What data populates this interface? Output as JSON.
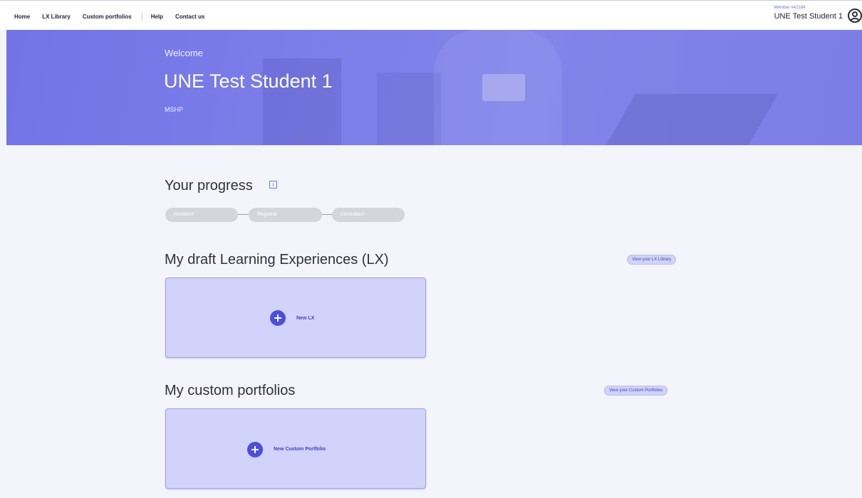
{
  "nav": {
    "items": [
      {
        "label": "Home"
      },
      {
        "label": "LX Library"
      },
      {
        "label": "Custom portfolios"
      },
      {
        "label": "Help"
      },
      {
        "label": "Contact us"
      }
    ]
  },
  "user": {
    "member_label": "Member #42184",
    "name": "UNE Test Student 1",
    "icon": "user-circle-icon"
  },
  "hero": {
    "welcome": "Welcome",
    "name": "UNE Test Student 1",
    "org": "MSHP"
  },
  "progress": {
    "title": "Your progress",
    "info_icon": "info-icon",
    "stages": [
      "Resident",
      "Registrar",
      "Consultant"
    ]
  },
  "drafts": {
    "title": "My draft Learning Experiences (LX)",
    "link": "View your LX Library",
    "new_label": "New LX"
  },
  "portfolios": {
    "title": "My custom portfolios",
    "link": "View your Custom Portfolios",
    "new_label": "New Custom Portfolio"
  },
  "colors": {
    "accent": "#4a4ee0",
    "hero": "#7b7de8",
    "card": "#d2d3fb"
  }
}
